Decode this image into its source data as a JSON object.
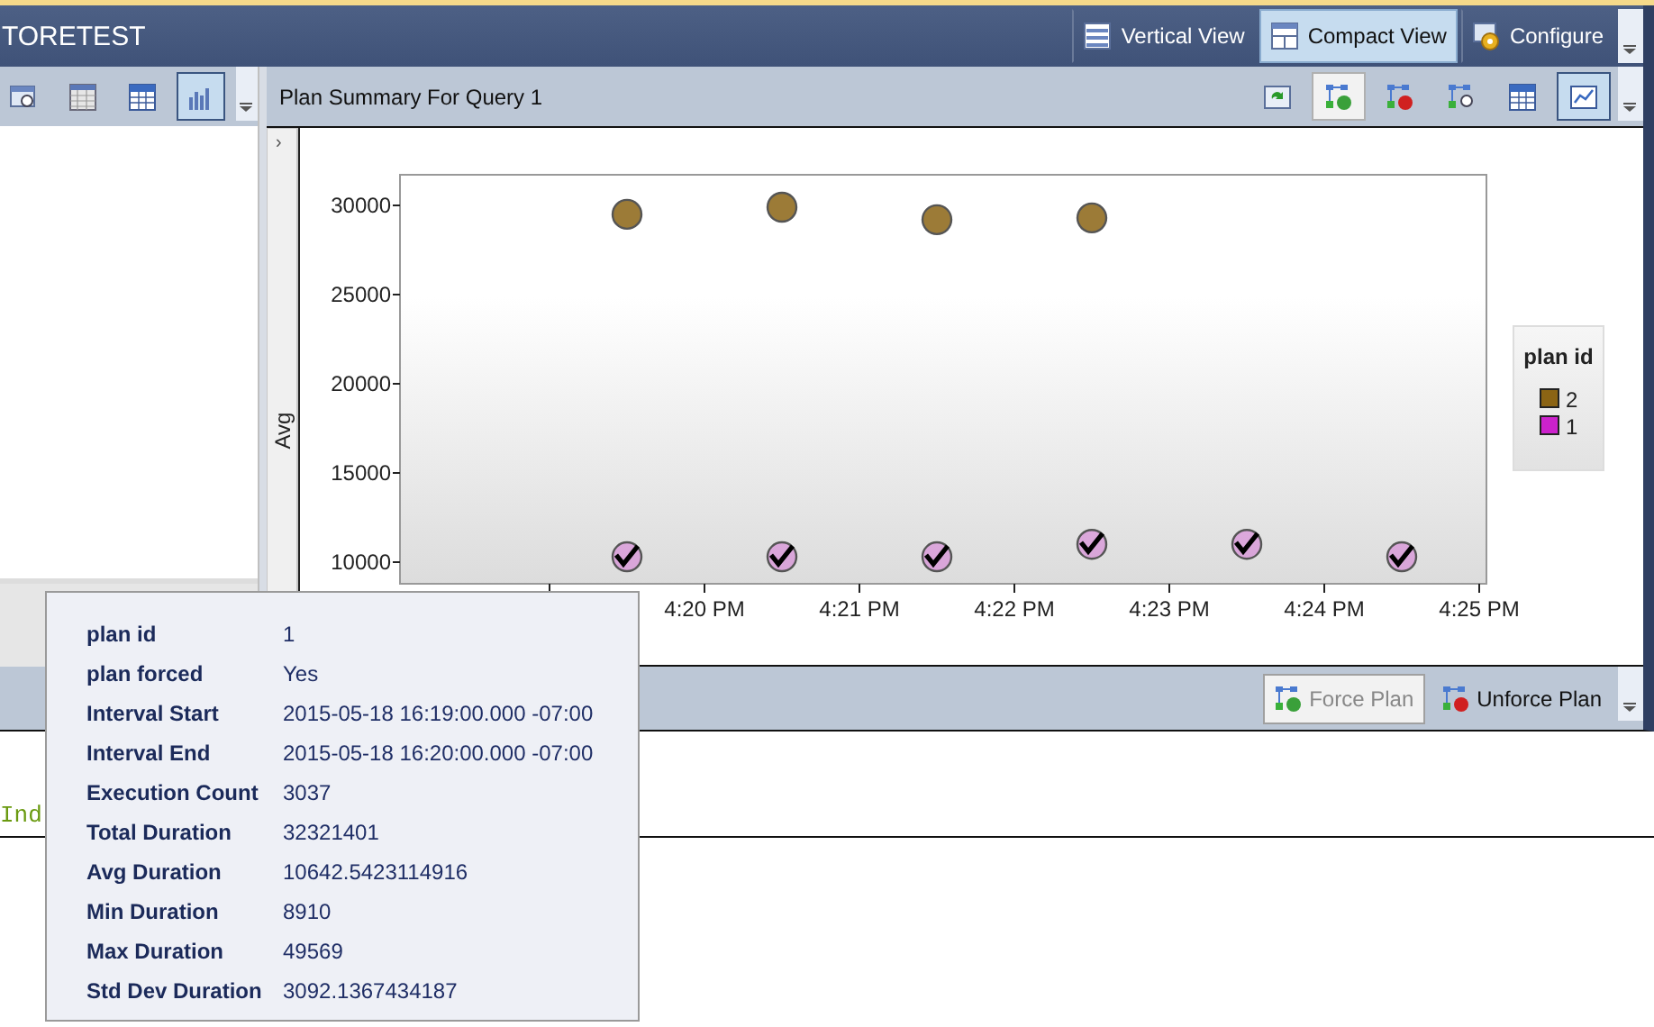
{
  "window": {
    "title": "TORETEST"
  },
  "view_buttons": [
    {
      "label": "Vertical View",
      "kind": "rows",
      "selected": false
    },
    {
      "label": "Compact View",
      "kind": "panes",
      "selected": true
    },
    {
      "label": "Configure",
      "kind": "gear",
      "selected": false
    }
  ],
  "left_toolbar": [
    {
      "kind": "window-search",
      "selected": false
    },
    {
      "kind": "grid",
      "selected": false
    },
    {
      "kind": "table",
      "selected": false
    },
    {
      "kind": "bars",
      "selected": true
    }
  ],
  "plan_summary": {
    "title": "Plan Summary For Query 1",
    "toolbar": [
      {
        "kind": "refresh",
        "selected": false,
        "pressed": false
      },
      {
        "kind": "plan-check",
        "selected": false,
        "pressed": true
      },
      {
        "kind": "plan-stop",
        "selected": false,
        "pressed": false
      },
      {
        "kind": "plan-search",
        "selected": false,
        "pressed": false
      },
      {
        "kind": "table",
        "selected": false,
        "pressed": false
      },
      {
        "kind": "line",
        "selected": true,
        "pressed": false
      }
    ],
    "collapse_glyph": "›",
    "series_markers": [
      {
        "kind": "circle"
      },
      {
        "kind": "check"
      }
    ],
    "chart_data": {
      "type": "scatter",
      "ylabel": "Avg",
      "ylim": [
        8788,
        31717
      ],
      "categories": [
        null,
        null,
        "4:20 PM",
        null,
        "4:21 PM",
        null,
        "4:22 PM",
        null,
        "4:23 PM",
        null,
        "4:24 PM",
        null,
        "4:25 PM"
      ],
      "yticks": [
        10000,
        15000,
        20000,
        25000,
        30000
      ],
      "legend": "right",
      "legend_title": "plan id",
      "series": [
        {
          "name": "2",
          "color": "#8b6414",
          "values": [
            null,
            29500,
            null,
            29900,
            null,
            29200,
            null,
            29300,
            null,
            null,
            null,
            null,
            null
          ]
        },
        {
          "name": "1",
          "color": "#cc22cc",
          "values": [
            null,
            10300,
            null,
            10300,
            null,
            10300,
            null,
            11000,
            null,
            11000,
            null,
            10300,
            null
          ]
        }
      ]
    }
  },
  "plan_actions": [
    {
      "label": "Force Plan",
      "kind": "plan-check",
      "disabled": true
    },
    {
      "label": "Unforce Plan",
      "kind": "plan-stop",
      "disabled": false
    }
  ],
  "query_text": "Ind",
  "tooltip": [
    {
      "label": "plan id",
      "value": "1"
    },
    {
      "label": "plan forced",
      "value": "Yes"
    },
    {
      "label": "Interval Start",
      "value": "2015-05-18 16:19:00.000 -07:00"
    },
    {
      "label": "Interval End",
      "value": "2015-05-18 16:20:00.000 -07:00"
    },
    {
      "label": "Execution Count",
      "value": "3037"
    },
    {
      "label": "Total Duration",
      "value": "32321401"
    },
    {
      "label": "Avg Duration",
      "value": "10642.5423114916"
    },
    {
      "label": "Min Duration",
      "value": "8910"
    },
    {
      "label": "Max Duration",
      "value": "49569"
    },
    {
      "label": "Std Dev Duration",
      "value": "3092.1367434187"
    }
  ]
}
